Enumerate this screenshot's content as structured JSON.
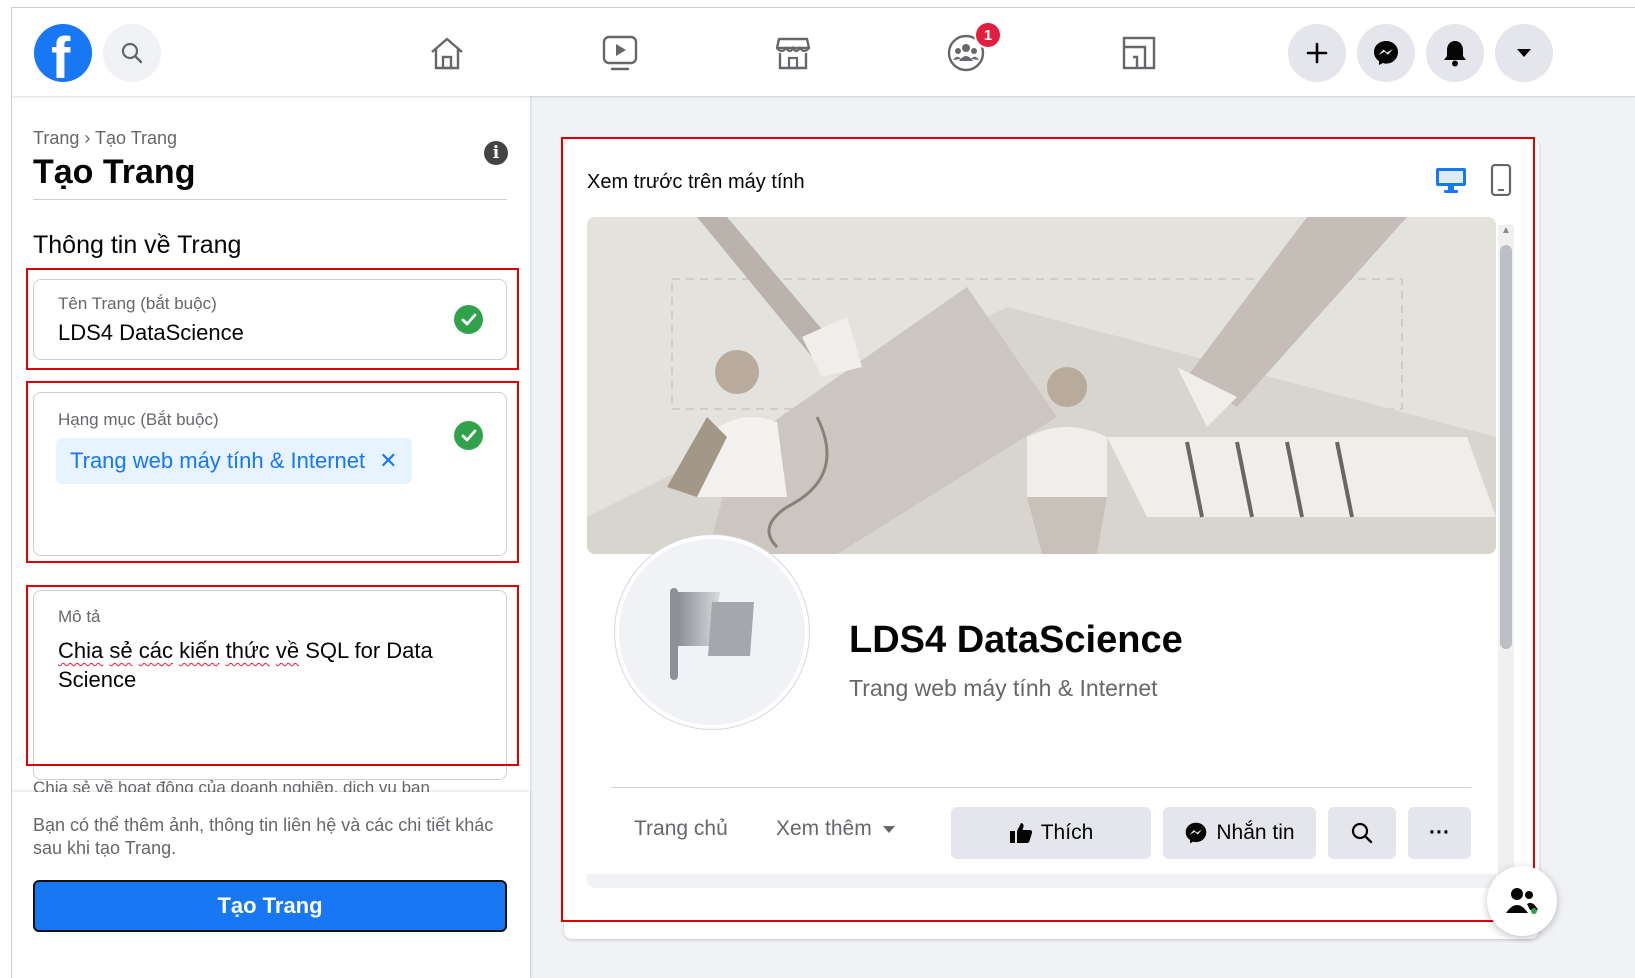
{
  "breadcrumb": "Trang › Tạo Trang",
  "page_title": "Tạo Trang",
  "section_title": "Thông tin về Trang",
  "fields": {
    "name": {
      "label": "Tên Trang (bắt buộc)",
      "value": "LDS4 DataScience"
    },
    "category": {
      "label": "Hạng mục (Bắt buộc)",
      "chip": "Trang web máy tính & Internet",
      "chip_remove": "✕"
    },
    "description": {
      "label": "Mô tả",
      "words": [
        "Chia",
        "sẻ",
        "các",
        "kiến",
        "thức",
        "về",
        "SQL for Data Science"
      ]
    }
  },
  "hint": "Chia sẻ về hoạt động của doanh nghiệp, dịch vụ bạn",
  "bottom_note": "Bạn có thể thêm ảnh, thông tin liên hệ và các chi tiết khác sau khi tạo Trang.",
  "create_button": "Tạo Trang",
  "notifications_badge": "1",
  "preview": {
    "title": "Xem trước trên máy tính",
    "page_name": "LDS4 DataScience",
    "page_category": "Trang web máy tính & Internet",
    "tabs": [
      "Trang chủ",
      "Xem thêm"
    ],
    "like_button": "Thích",
    "message_button": "Nhắn tin",
    "more_button": "···"
  },
  "colors": {
    "brand": "#1877f2",
    "success": "#31a24c",
    "highlight_box": "#e00000",
    "badge": "#e41e3f"
  }
}
